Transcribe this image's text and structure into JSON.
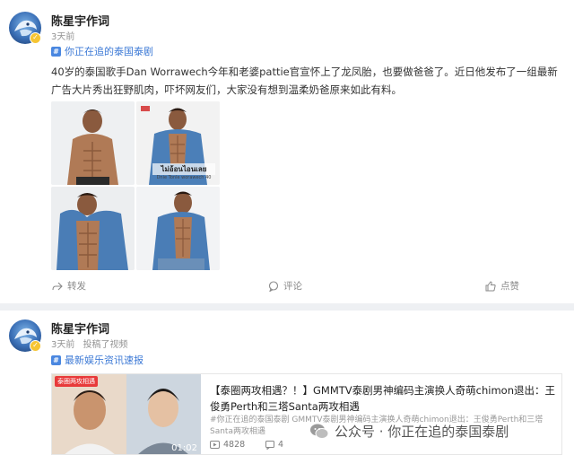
{
  "post1": {
    "author": "陈星宇作词",
    "time": "3天前",
    "topic": "你正在追的泰国泰剧",
    "text": "40岁的泰国歌手Dan Worrawech今年和老婆pattie官宣怀上了龙凤胎，也要做爸爸了。近日他发布了一组最新广告大片秀出狂野肌肉，吓坏网友们，大家没有想到温柔奶爸原来如此有料。",
    "image_caption": "ไม่อ้อนไอนเลย",
    "image_subcaption": "Dnie Tonle worawech 40",
    "actions": {
      "share": "转发",
      "comment": "评论",
      "like": "点赞"
    }
  },
  "post2": {
    "author": "陈星宇作词",
    "time": "3天前",
    "meta_action": "投稿了视频",
    "topic": "最新娱乐资讯速报",
    "news": {
      "title": "【泰圈两攻相遇？！】GMMTV泰剧男神编码主演换人奇萌chimon退出：王俊勇Perth和三塔Santa两攻相遇",
      "desc": "#你正在追的泰国泰剧 GMMTV泰剧男神编码主演换人奇萌chimon退出：王俊勇Perth和三塔Santa两攻相遇",
      "duration": "01:02",
      "badge": "泰圈两攻相遇",
      "views": "4828",
      "comments": "4"
    }
  },
  "watermark": "公众号 · 你正在追的泰国泰剧",
  "colors": {
    "link": "#3d7ad6",
    "badge": "#f6c533"
  }
}
